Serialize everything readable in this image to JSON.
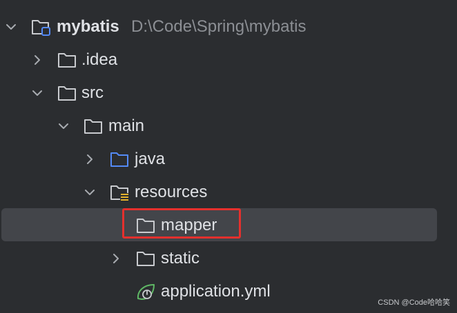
{
  "project_tree": {
    "root": {
      "name": "mybatis",
      "path": "D:\\Code\\Spring\\mybatis"
    },
    "items": [
      {
        "label": ".idea"
      },
      {
        "label": "src"
      },
      {
        "label": "main"
      },
      {
        "label": "java"
      },
      {
        "label": "resources"
      },
      {
        "label": "mapper"
      },
      {
        "label": "static"
      },
      {
        "label": "application.yml"
      }
    ]
  },
  "colors": {
    "background": "#2b2d30",
    "selection": "#43454a",
    "highlight_box": "#e5302d",
    "source_folder": "#548af7",
    "spring_leaf": "#5fb865"
  },
  "icons": {
    "root": "module-folder-icon",
    "folder": "folder-icon",
    "source": "source-folder-icon",
    "resources": "resources-folder-icon",
    "yml": "spring-leaf-icon"
  },
  "watermark": "CSDN @Code哈哈笑"
}
